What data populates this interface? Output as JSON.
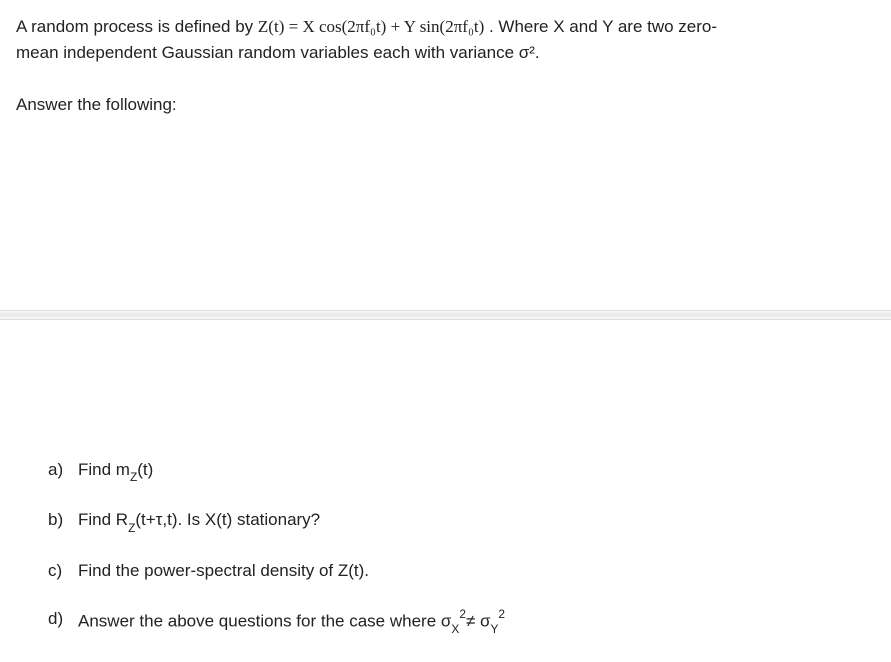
{
  "problem": {
    "line1_prefix": "A random process is defined by ",
    "equation": "Z(t) = X cos(2πf₀t)  +  Y sin(2πf₀t)",
    "line1_suffix": " . Where X and Y are two zero-",
    "line2": "mean independent Gaussian random variables each with variance σ².",
    "prompt": "Answer the following:"
  },
  "questions": {
    "a": {
      "label": "a)",
      "text": "Find m",
      "sub": "Z",
      "after": "(t)"
    },
    "b": {
      "label": "b)",
      "text_prefix": "Find R",
      "sub": "Z",
      "mid": "(t+τ,t). Is X(t) stationary?"
    },
    "c": {
      "label": "c)",
      "text": "Find the power-spectral density of Z(t)."
    },
    "d": {
      "label": "d)",
      "text_prefix": "Answer the above questions for the case where σ",
      "subX": "X",
      "sup1": "2",
      "neq": "≠ σ",
      "subY": "Y",
      "sup2": "2"
    }
  }
}
